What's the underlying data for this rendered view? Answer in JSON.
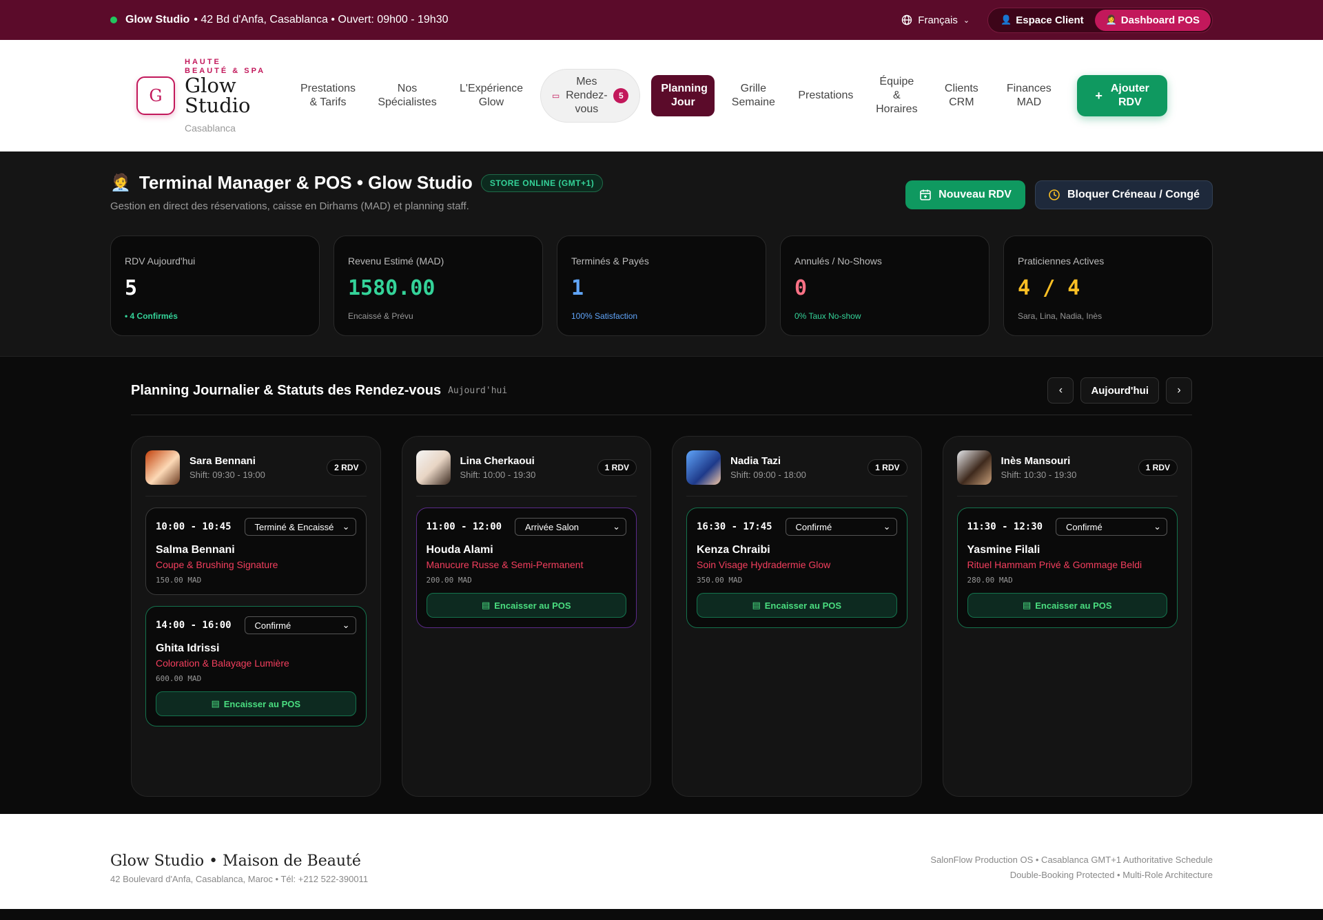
{
  "topbar": {
    "brand": "Glow Studio",
    "info": "• 42 Bd d'Anfa, Casablanca • Ouvert: 09h00 - 19h30",
    "language": "Français",
    "espace_client": "Espace Client",
    "dashboard_pos": "Dashboard POS"
  },
  "logo": {
    "mark": "G",
    "tagline": "HAUTE BEAUTÉ & SPA",
    "name": "Glow Studio",
    "city": "Casablanca"
  },
  "nav": {
    "items": [
      "Prestations & Tarifs",
      "Nos Spécialistes",
      "L'Expérience Glow",
      "Mes Rendez-vous",
      "Planning Jour",
      "Grille Semaine",
      "Prestations",
      "Équipe & Horaires",
      "Clients CRM",
      "Finances MAD"
    ],
    "rdv_count": "5",
    "add_button": "Ajouter RDV"
  },
  "hero": {
    "title": "Terminal Manager & POS • Glow Studio",
    "store_badge": "STORE ONLINE (GMT+1)",
    "subtitle": "Gestion en direct des réservations, caisse en Dirhams (MAD) et planning staff.",
    "new_rdv": "Nouveau RDV",
    "block_slot": "Bloquer Créneau / Congé"
  },
  "stats": [
    {
      "label": "RDV Aujourd'hui",
      "value": "5",
      "foot": "• 4 Confirmés",
      "value_color": "#ffffff",
      "foot_color": "#34d399"
    },
    {
      "label": "Revenu Estimé (MAD)",
      "value": "1580.00",
      "foot": "Encaissé & Prévu",
      "value_color": "#34d399",
      "foot_color": "#999999"
    },
    {
      "label": "Terminés & Payés",
      "value": "1",
      "foot": "100% Satisfaction",
      "value_color": "#60a5fa",
      "foot_color": "#60a5fa"
    },
    {
      "label": "Annulés / No-Shows",
      "value": "0",
      "foot": "0% Taux No-show",
      "value_color": "#fb7185",
      "foot_color": "#34d399"
    },
    {
      "label": "Praticiennes Actives",
      "value": "4 / 4",
      "foot": "Sara, Lina, Nadia, Inès",
      "value_color": "#fbbf24",
      "foot_color": "#999999"
    }
  ],
  "planning": {
    "title": "Planning Journalier & Statuts des Rendez-vous",
    "subtitle": "Aujourd'hui",
    "today_button": "Aujourd'hui",
    "pos_label": "Encaisser au POS",
    "staff": [
      {
        "name": "Sara Bennani",
        "shift": "Shift: 09:30 - 19:00",
        "count": "2 RDV",
        "appointments": [
          {
            "time": "10:00 - 10:45",
            "status": "Terminé & Encaissé",
            "client": "Salma Bennani",
            "service": "Coupe & Brushing Signature",
            "price": "150.00 MAD"
          },
          {
            "time": "14:00 - 16:00",
            "status": "Confirmé",
            "client": "Ghita Idrissi",
            "service": "Coloration & Balayage Lumière",
            "price": "600.00 MAD"
          }
        ]
      },
      {
        "name": "Lina Cherkaoui",
        "shift": "Shift: 10:00 - 19:30",
        "count": "1 RDV",
        "appointments": [
          {
            "time": "11:00 - 12:00",
            "status": "Arrivée Salon",
            "client": "Houda Alami",
            "service": "Manucure Russe & Semi-Permanent",
            "price": "200.00 MAD"
          }
        ]
      },
      {
        "name": "Nadia Tazi",
        "shift": "Shift: 09:00 - 18:00",
        "count": "1 RDV",
        "appointments": [
          {
            "time": "16:30 - 17:45",
            "status": "Confirmé",
            "client": "Kenza Chraibi",
            "service": "Soin Visage Hydradermie Glow",
            "price": "350.00 MAD"
          }
        ]
      },
      {
        "name": "Inès Mansouri",
        "shift": "Shift: 10:30 - 19:30",
        "count": "1 RDV",
        "appointments": [
          {
            "time": "11:30 - 12:30",
            "status": "Confirmé",
            "client": "Yasmine Filali",
            "service": "Rituel Hammam Privé & Gommage Beldi",
            "price": "280.00 MAD"
          }
        ]
      }
    ]
  },
  "footer": {
    "brand": "Glow Studio • Maison de Beauté",
    "address": "42 Boulevard d'Anfa, Casablanca, Maroc • Tél: +212 522-390011",
    "line1": "SalonFlow Production OS • Casablanca GMT+1 Authoritative Schedule",
    "line2": "Double-Booking Protected • Multi-Role Architecture"
  },
  "colors": {
    "brand": "#5b0b2a",
    "accent": "#c2185b",
    "green": "#0f9960",
    "done_border": "#3a3a3a",
    "arrived_border": "#5b2a8a",
    "confirmed_border": "#14734d"
  }
}
